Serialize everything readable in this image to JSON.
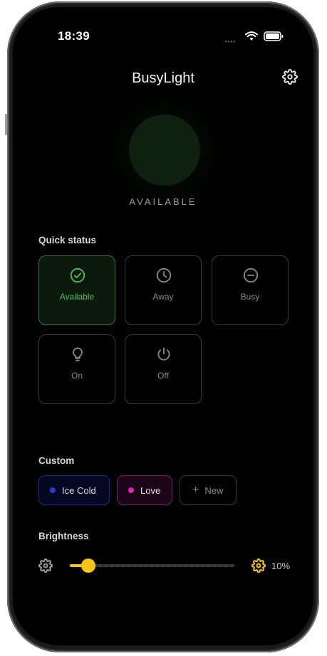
{
  "status_bar": {
    "time": "18:39"
  },
  "header": {
    "title": "BusyLight",
    "settings_icon": "gear-icon"
  },
  "current_status": {
    "label": "AVAILABLE",
    "color": "#0f1f10"
  },
  "quick_status": {
    "title": "Quick status",
    "items": [
      {
        "label": "Available",
        "icon": "check-circle-icon",
        "active": true
      },
      {
        "label": "Away",
        "icon": "clock-icon",
        "active": false
      },
      {
        "label": "Busy",
        "icon": "minus-circle-icon",
        "active": false
      },
      {
        "label": "On",
        "icon": "lightbulb-icon",
        "active": false
      },
      {
        "label": "Off",
        "icon": "power-icon",
        "active": false
      }
    ]
  },
  "custom": {
    "title": "Custom",
    "items": [
      {
        "label": "Ice Cold",
        "color": "#2a3bd6"
      },
      {
        "label": "Love",
        "color": "#d62ab5"
      }
    ],
    "new_label": "New"
  },
  "brightness": {
    "title": "Brightness",
    "value_label": "10%",
    "level": 0.1,
    "accent": "#f5c518"
  }
}
